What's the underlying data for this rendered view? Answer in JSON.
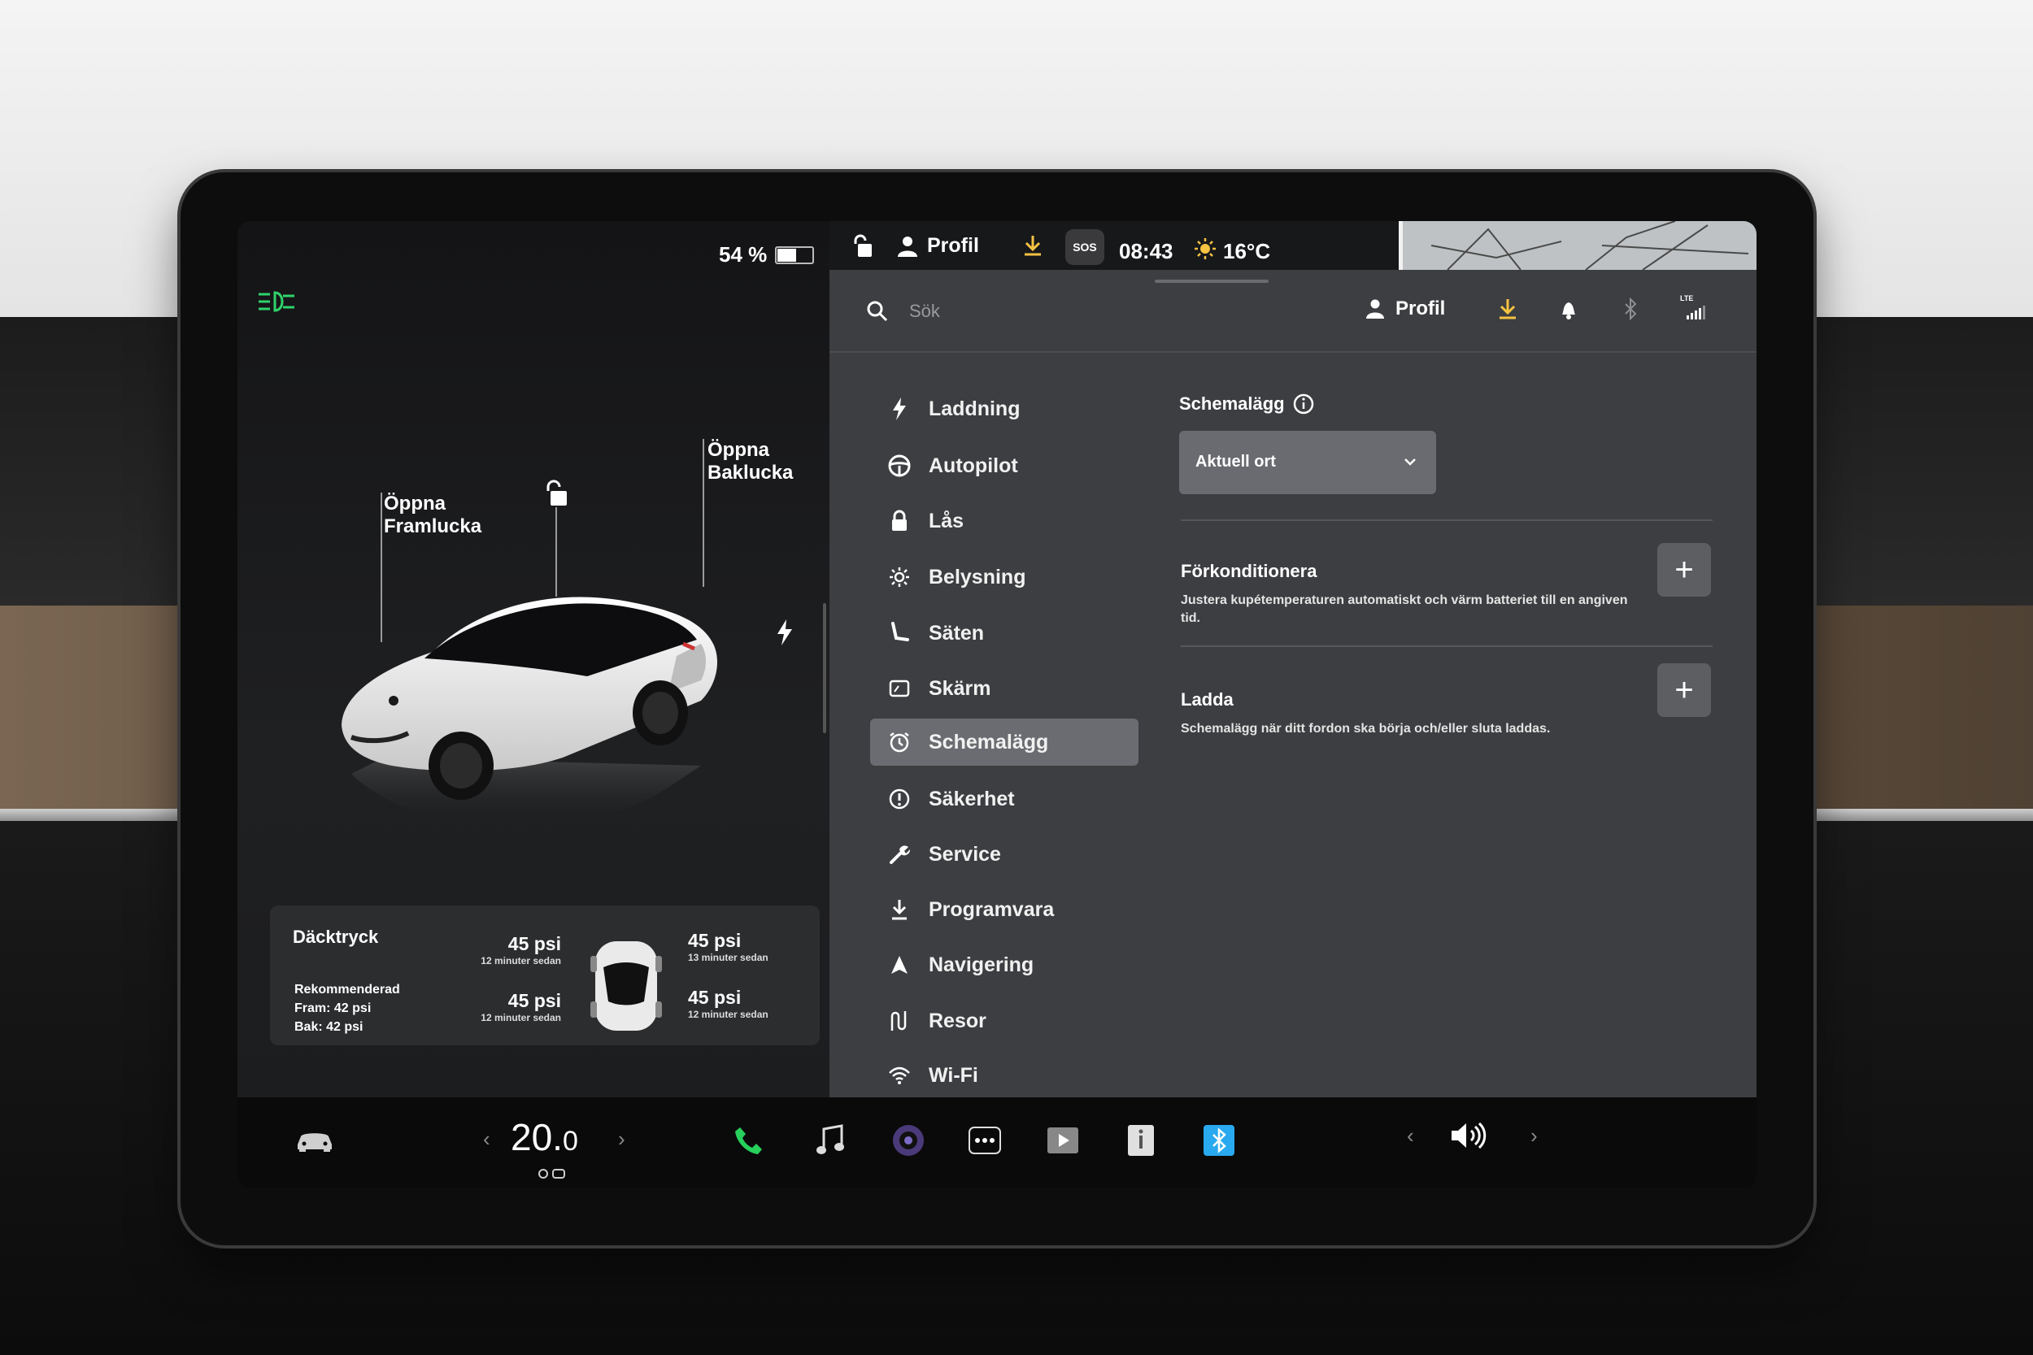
{
  "status_bar": {
    "battery": "54 %",
    "profile": "Profil",
    "sos": "SOS",
    "time": "08:43",
    "temperature": "16°C"
  },
  "left_panel": {
    "open_front": [
      "Öppna",
      "Framlucka"
    ],
    "open_rear": [
      "Öppna",
      "Baklucka"
    ]
  },
  "tires": {
    "title": "Däcktryck",
    "recommended_label": "Rekommenderad",
    "front": "Fram: 42 psi",
    "rear": "Bak: 42 psi",
    "fl": {
      "value": "45 psi",
      "time": "12 minuter sedan"
    },
    "rl": {
      "value": "45 psi",
      "time": "12 minuter sedan"
    },
    "fr": {
      "value": "45 psi",
      "time": "13 minuter sedan"
    },
    "rr": {
      "value": "45 psi",
      "time": "12 minuter sedan"
    }
  },
  "settings_header": {
    "search_placeholder": "Sök",
    "profile": "Profil",
    "lte": "LTE"
  },
  "menu": [
    {
      "label": "Laddning",
      "icon": "bolt-icon"
    },
    {
      "label": "Autopilot",
      "icon": "steering-wheel-icon"
    },
    {
      "label": "Lås",
      "icon": "lock-icon"
    },
    {
      "label": "Belysning",
      "icon": "sun-icon"
    },
    {
      "label": "Säten",
      "icon": "seat-icon"
    },
    {
      "label": "Skärm",
      "icon": "display-icon"
    },
    {
      "label": "Schemalägg",
      "icon": "alarm-clock-icon",
      "active": true
    },
    {
      "label": "Säkerhet",
      "icon": "alert-icon"
    },
    {
      "label": "Service",
      "icon": "wrench-icon"
    },
    {
      "label": "Programvara",
      "icon": "download-icon"
    },
    {
      "label": "Navigering",
      "icon": "navigation-icon"
    },
    {
      "label": "Resor",
      "icon": "trips-icon"
    },
    {
      "label": "Wi-Fi",
      "icon": "wifi-icon"
    }
  ],
  "schedule": {
    "title": "Schemalägg",
    "location_select": "Aktuell ort",
    "precondition_title": "Förkonditionera",
    "precondition_desc": "Justera kupétemperaturen automatiskt och värm batteriet till en angiven tid.",
    "charge_title": "Ladda",
    "charge_desc": "Schemalägg när ditt fordon ska börja och/eller sluta laddas."
  },
  "taskbar": {
    "temp_whole": "20.",
    "temp_decimal": "0"
  },
  "colors": {
    "accent_yellow": "#f5c242",
    "headlight_green": "#2fd36b",
    "phone_green": "#27d05b",
    "bluetooth_blue": "#29a9ef"
  }
}
